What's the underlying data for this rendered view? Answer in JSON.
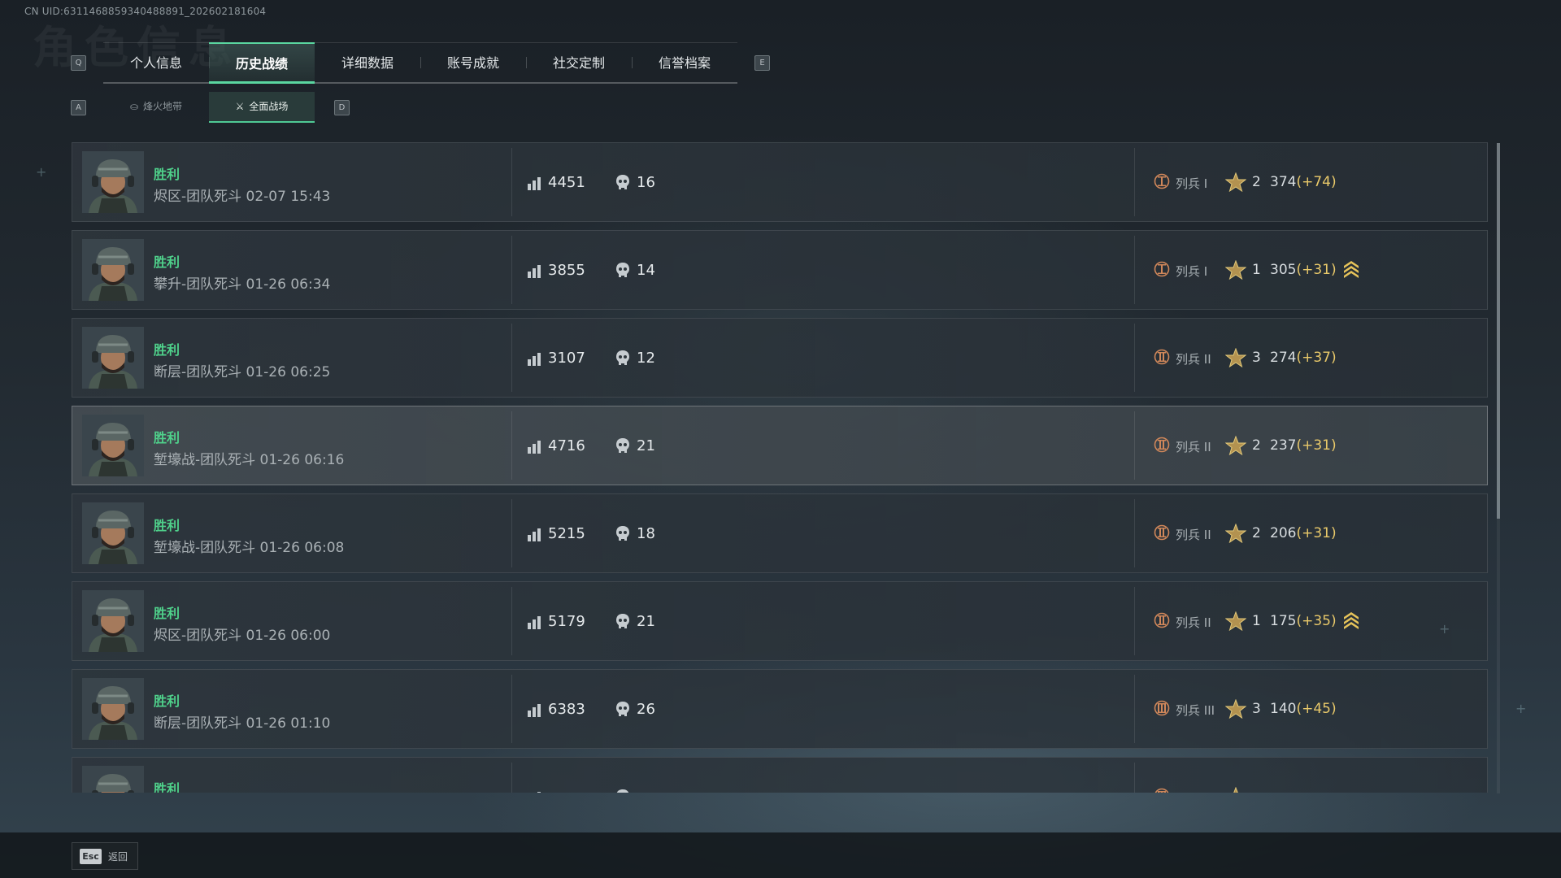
{
  "uid": "CN UID:6311468859340488891_202602181604",
  "ghost_title": "角色信息",
  "nav": {
    "prev_key": "Q",
    "next_key": "E",
    "tabs": [
      "个人信息",
      "历史战绩",
      "详细数据",
      "账号成就",
      "社交定制",
      "信誉档案"
    ],
    "active_tab": 1
  },
  "subnav": {
    "prev_key": "A",
    "next_key": "D",
    "tabs": [
      "烽火地带",
      "全面战场"
    ],
    "active_tab": 1
  },
  "colors": {
    "accent": "#4fd18b",
    "delta": "#e9c96a",
    "rank": "#d0875a"
  },
  "matches": [
    {
      "result": "胜利",
      "map": "烬区-团队死斗 02-07 15:43",
      "score": "4451",
      "kills": "16",
      "rank_icon": "rank-1-icon",
      "rank": "列兵 I",
      "stars": "2",
      "points": "374",
      "delta": "(+74)",
      "promoted": false
    },
    {
      "result": "胜利",
      "map": "攀升-团队死斗 01-26 06:34",
      "score": "3855",
      "kills": "14",
      "rank_icon": "rank-1-icon",
      "rank": "列兵 I",
      "stars": "1",
      "points": "305",
      "delta": "(+31)",
      "promoted": true
    },
    {
      "result": "胜利",
      "map": "断层-团队死斗 01-26 06:25",
      "score": "3107",
      "kills": "12",
      "rank_icon": "rank-2-icon",
      "rank": "列兵 II",
      "stars": "3",
      "points": "274",
      "delta": "(+37)",
      "promoted": false
    },
    {
      "result": "胜利",
      "map": "堑壕战-团队死斗 01-26 06:16",
      "score": "4716",
      "kills": "21",
      "rank_icon": "rank-2-icon",
      "rank": "列兵 II",
      "stars": "2",
      "points": "237",
      "delta": "(+31)",
      "promoted": false
    },
    {
      "result": "胜利",
      "map": "堑壕战-团队死斗 01-26 06:08",
      "score": "5215",
      "kills": "18",
      "rank_icon": "rank-2-icon",
      "rank": "列兵 II",
      "stars": "2",
      "points": "206",
      "delta": "(+31)",
      "promoted": false
    },
    {
      "result": "胜利",
      "map": "烬区-团队死斗 01-26 06:00",
      "score": "5179",
      "kills": "21",
      "rank_icon": "rank-2-icon",
      "rank": "列兵 II",
      "stars": "1",
      "points": "175",
      "delta": "(+35)",
      "promoted": true
    },
    {
      "result": "胜利",
      "map": "断层-团队死斗 01-26 01:10",
      "score": "6383",
      "kills": "26",
      "rank_icon": "rank-3-icon",
      "rank": "列兵 III",
      "stars": "3",
      "points": "140",
      "delta": "(+45)",
      "promoted": false
    },
    {
      "result": "胜利",
      "map": "",
      "score": "",
      "kills": "",
      "rank_icon": "rank-3-icon",
      "rank": "",
      "stars": "",
      "points": "",
      "delta": "",
      "promoted": false
    }
  ],
  "footer": {
    "key": "Esc",
    "label": "返回"
  }
}
